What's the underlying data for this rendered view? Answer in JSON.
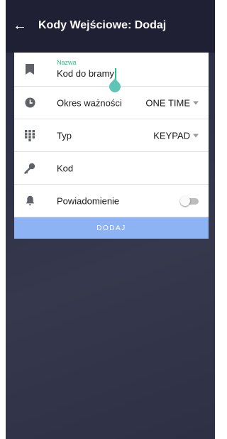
{
  "header": {
    "back_icon": "arrow-left-icon",
    "title": "Kody Wejściowe: Dodaj"
  },
  "form": {
    "name": {
      "icon": "bookmark-icon",
      "caption": "Nazwa",
      "value": "Kod do bramy"
    },
    "validity": {
      "icon": "clock-icon",
      "label": "Okres ważności",
      "value": "ONE TIME"
    },
    "type": {
      "icon": "keypad-icon",
      "label": "Typ",
      "value": "KEYPAD"
    },
    "code": {
      "icon": "key-icon",
      "label": "Kod"
    },
    "notification": {
      "icon": "bell-icon",
      "label": "Powiadomienie",
      "enabled": false
    },
    "submit_label": "DODAJ"
  },
  "colors": {
    "app_background": "#303248",
    "appbar": "#1f2034",
    "accent_green": "#26c281",
    "submit_button": "#8db3f5",
    "icon_gray": "#5f6368"
  }
}
